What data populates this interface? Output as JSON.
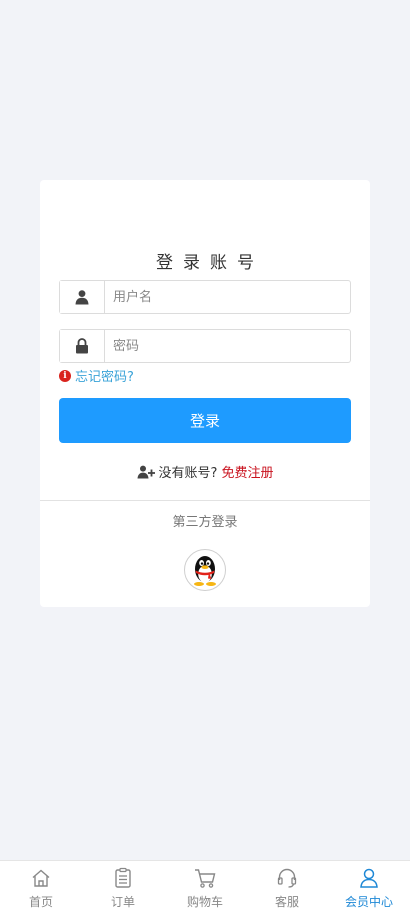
{
  "login": {
    "title": "登录账号",
    "username_placeholder": "用户名",
    "password_placeholder": "密码",
    "forgot_link": "忘记密码?",
    "login_button": "登录",
    "no_account_text": "没有账号?",
    "register_link": "免费注册",
    "third_party_label": "第三方登录"
  },
  "icons": {
    "username": "user-icon",
    "password": "lock-icon",
    "forgot": "info-icon",
    "register": "add-user-icon",
    "third_party": "qq-penguin-icon"
  },
  "tabbar": {
    "active": "会员中心",
    "tabs": [
      {
        "label": "首页",
        "icon": "home-icon"
      },
      {
        "label": "订单",
        "icon": "order-icon"
      },
      {
        "label": "购物车",
        "icon": "cart-icon"
      },
      {
        "label": "客服",
        "icon": "headset-icon"
      },
      {
        "label": "会员中心",
        "icon": "member-icon"
      }
    ]
  },
  "colors": {
    "primary": "#1e9bff",
    "link": "#3aa3d8",
    "register": "#c9121e",
    "tab_active": "#1e88d6",
    "background": "#f2f3f8"
  }
}
